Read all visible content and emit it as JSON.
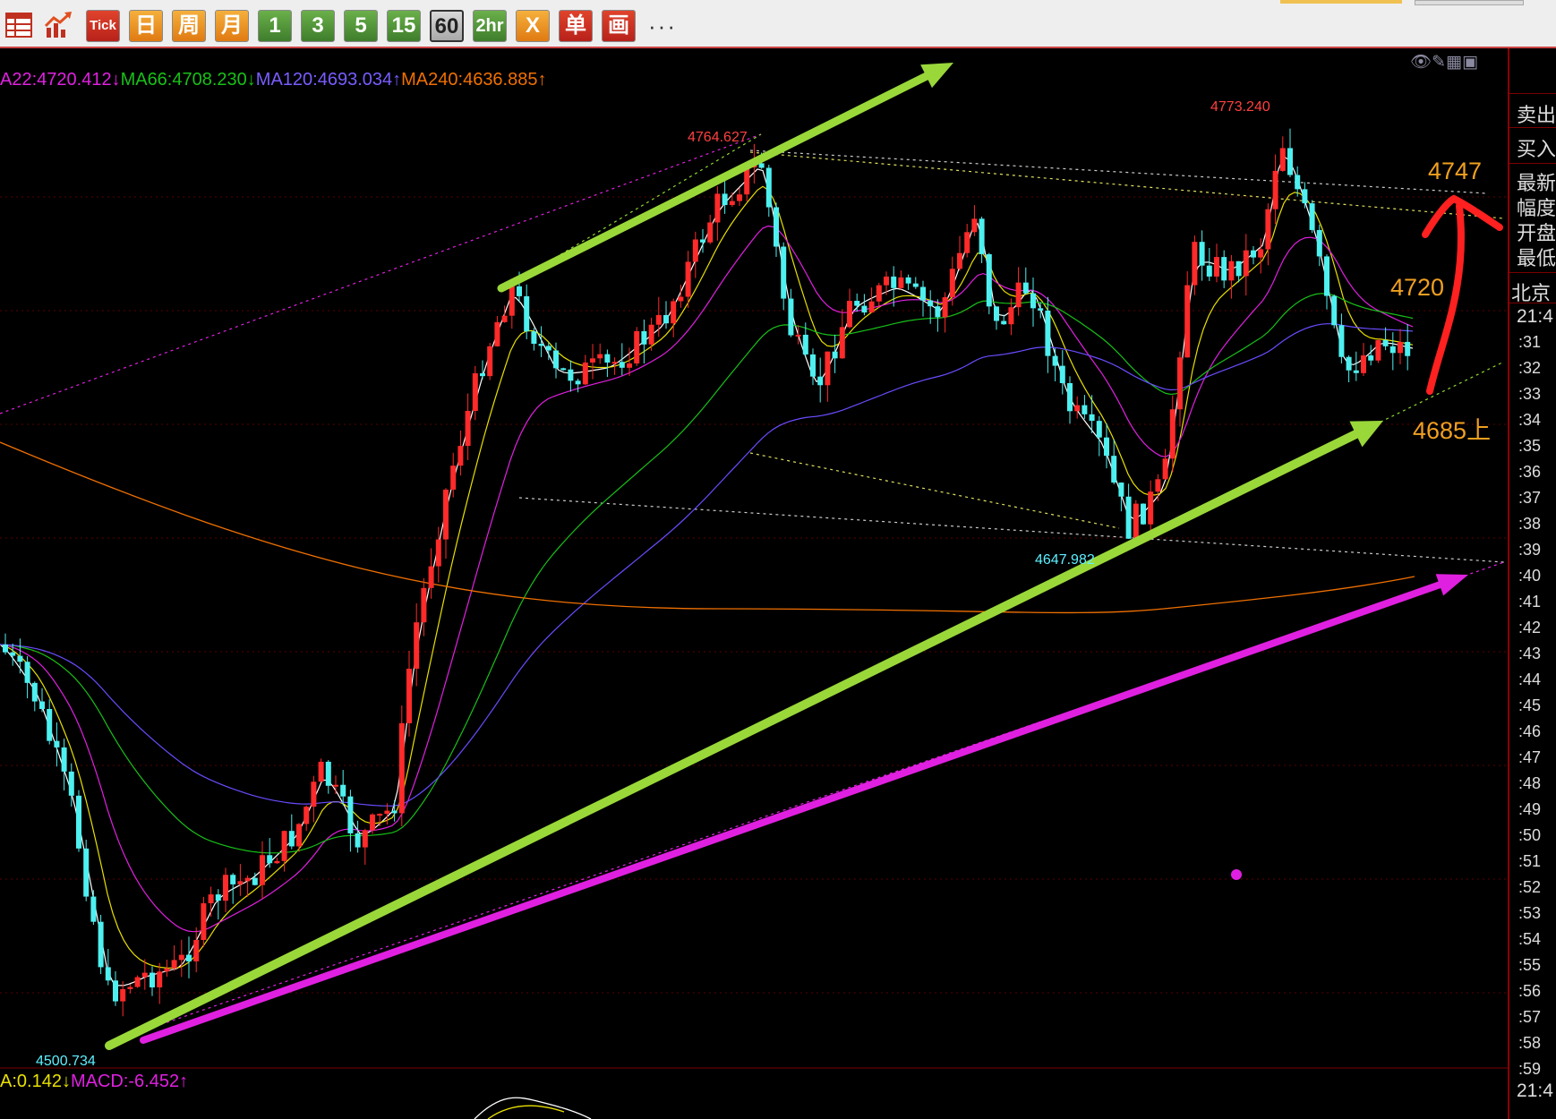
{
  "toolbar": {
    "buttons": [
      {
        "label": "",
        "icon": "grid-table-icon"
      },
      {
        "label": "",
        "icon": "trend-chart-icon"
      },
      {
        "label": "Tick"
      },
      {
        "label": "日"
      },
      {
        "label": "周"
      },
      {
        "label": "月"
      },
      {
        "label": "1"
      },
      {
        "label": "3"
      },
      {
        "label": "5"
      },
      {
        "label": "15"
      },
      {
        "label": "60",
        "selected": true
      },
      {
        "label": "2hr"
      },
      {
        "label": "X"
      },
      {
        "label": "单"
      },
      {
        "label": "画"
      }
    ],
    "more_label": "···"
  },
  "ma_legend": {
    "ma22": "A22:4720.412↓",
    "ma66": "MA66:4708.230↓",
    "ma120": "MA120:4693.034↑",
    "ma240": "MA240:4636.885↑"
  },
  "macd_legend": {
    "dea": "A:0.142↓",
    "macd": "MACD:-6.452↑"
  },
  "chart_tools": "👁✎▦▣",
  "chart_data": {
    "type": "candlestick",
    "interval": "60",
    "y_range": [
      4495,
      4790
    ],
    "extremes": [
      {
        "label": "4764.627",
        "value": 4764.627
      },
      {
        "label": "4773.240",
        "value": 4773.24
      },
      {
        "label": "4647.982",
        "value": 4647.982
      },
      {
        "label": "4500.734",
        "value": 4500.734
      }
    ],
    "annotations": [
      {
        "text": "4747",
        "value": 4747
      },
      {
        "text": "4720",
        "value": 4720
      },
      {
        "text": "4685上",
        "value": 4685
      }
    ],
    "colors": {
      "up": "#ff2a2a",
      "down": "#4ef0f0",
      "ma_white": "#ffffff",
      "ma_yellow": "#e8e000",
      "ma22": "#e020e0",
      "ma66": "#18c018",
      "ma120": "#6a4cff",
      "ma240": "#f07000",
      "arrow_green": "#9ad83a",
      "arrow_magenta": "#e020e0",
      "arrow_red": "#ff2020"
    }
  },
  "right_panel": {
    "labels": [
      "卖出",
      "买入",
      "最新",
      "幅度",
      "开盘",
      "最低",
      "北京"
    ],
    "time": "21:4",
    "ticks": [
      ":31",
      ":32",
      ":33",
      ":34",
      ":35",
      ":36",
      ":37",
      ":38",
      ":39",
      ":40",
      ":41",
      ":42",
      ":43",
      ":44",
      ":45",
      ":46",
      ":47",
      ":48",
      ":49",
      ":50",
      ":51",
      ":52",
      ":53",
      ":54",
      ":55",
      ":56",
      ":57",
      ":58",
      ":59"
    ],
    "time_bottom": "21:4"
  }
}
